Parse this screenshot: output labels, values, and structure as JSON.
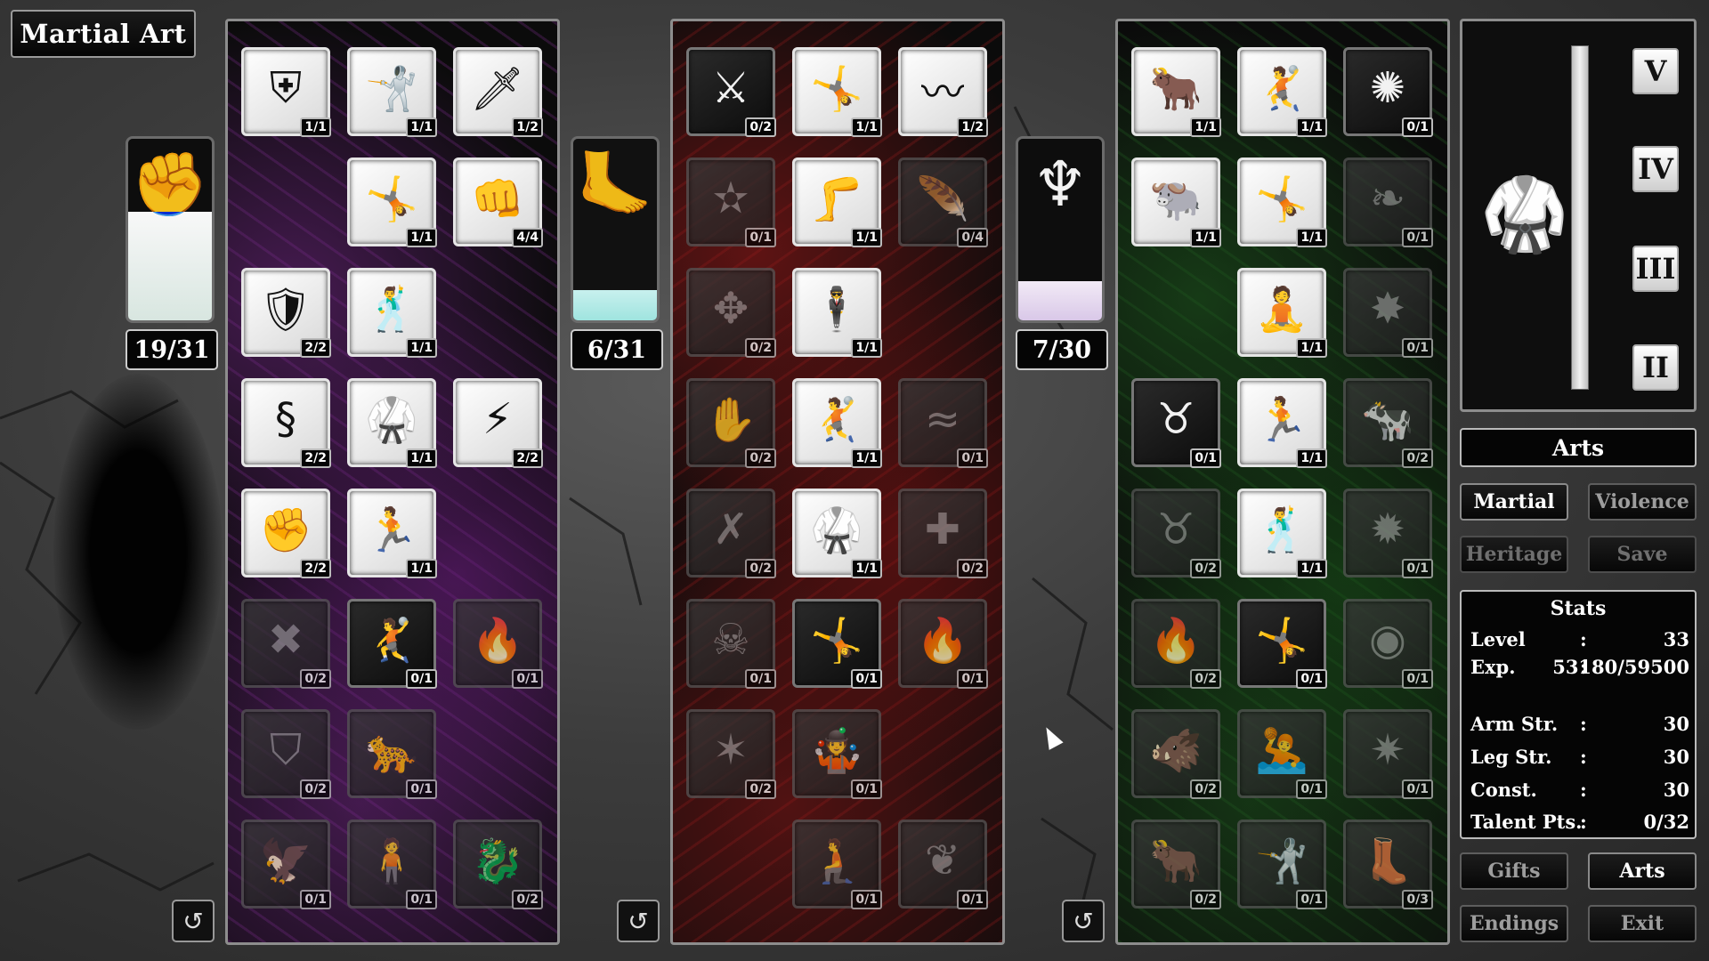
{
  "title": "Martial Art",
  "trees": [
    {
      "theme": "purple",
      "counter": "19/31",
      "category_icon": "fist-icon",
      "category_progress": 0.61,
      "skills": [
        {
          "icon": "shield-icon",
          "glyph": "⛨",
          "count": "1/1",
          "state": "unlocked"
        },
        {
          "icon": "fighter-punch-icon",
          "glyph": "🤺",
          "count": "1/1",
          "state": "unlocked"
        },
        {
          "icon": "sword-strike-icon",
          "glyph": "🗡",
          "count": "1/2",
          "state": "unlocked"
        },
        null,
        {
          "icon": "fighter-lunge-icon",
          "glyph": "🤸",
          "count": "1/1",
          "state": "unlocked"
        },
        {
          "icon": "fast-fist-icon",
          "glyph": "👊",
          "count": "4/4",
          "state": "unlocked"
        },
        {
          "icon": "black-shield-icon",
          "glyph": "🛡",
          "count": "2/2",
          "state": "unlocked"
        },
        {
          "icon": "fighter-stance-icon",
          "glyph": "🕺",
          "count": "1/1",
          "state": "unlocked"
        },
        null,
        {
          "icon": "serpent-icon",
          "glyph": "§",
          "count": "2/2",
          "state": "unlocked"
        },
        {
          "icon": "fighter-guard-icon",
          "glyph": "🥋",
          "count": "1/1",
          "state": "unlocked"
        },
        {
          "icon": "lightning-fist-icon",
          "glyph": "⚡",
          "count": "2/2",
          "state": "unlocked"
        },
        {
          "icon": "shield-fist-icon",
          "glyph": "✊",
          "count": "2/2",
          "state": "unlocked"
        },
        {
          "icon": "fighter-hook-icon",
          "glyph": "🏃",
          "count": "1/1",
          "state": "unlocked"
        },
        null,
        {
          "icon": "crossed-arms-icon",
          "glyph": "✖",
          "count": "0/2",
          "state": "locked"
        },
        {
          "icon": "fighter-kick-high-icon",
          "glyph": "🤾",
          "count": "0/1",
          "state": "dark"
        },
        {
          "icon": "flaming-fist-icon",
          "glyph": "🔥",
          "count": "0/1",
          "state": "locked"
        },
        {
          "icon": "shield-strike-icon",
          "glyph": "⛉",
          "count": "0/2",
          "state": "locked"
        },
        {
          "icon": "fighter-crouch-icon",
          "glyph": "🐆",
          "count": "0/1",
          "state": "locked"
        },
        null,
        {
          "icon": "phoenix-icon",
          "glyph": "🦅",
          "count": "0/1",
          "state": "locked"
        },
        {
          "icon": "fighter-pose-icon",
          "glyph": "🧍",
          "count": "0/1",
          "state": "locked"
        },
        {
          "icon": "dragon-flame-icon",
          "glyph": "🐉",
          "count": "0/2",
          "state": "locked"
        }
      ]
    },
    {
      "theme": "red",
      "counter": "6/31",
      "category_icon": "foot-icon",
      "category_progress": 0.19,
      "skills": [
        {
          "icon": "crossed-swords-icon",
          "glyph": "⚔",
          "count": "0/2",
          "state": "dark"
        },
        {
          "icon": "fighter-kneel-kick-icon",
          "glyph": "🤸",
          "count": "1/1",
          "state": "unlocked"
        },
        {
          "icon": "flowing-hair-icon",
          "glyph": "〰",
          "count": "1/2",
          "state": "unlocked"
        },
        {
          "icon": "star-orbit-icon",
          "glyph": "✫",
          "count": "0/1",
          "state": "locked"
        },
        {
          "icon": "fighter-side-kick-icon",
          "glyph": "🦵",
          "count": "1/1",
          "state": "unlocked"
        },
        {
          "icon": "feathered-wing-icon",
          "glyph": "🪶",
          "count": "0/4",
          "state": "locked"
        },
        {
          "icon": "sword-hands-icon",
          "glyph": "✥",
          "count": "0/2",
          "state": "locked"
        },
        {
          "icon": "fighter-knee-icon",
          "glyph": "🕴",
          "count": "1/1",
          "state": "unlocked"
        },
        null,
        {
          "icon": "grab-star-icon",
          "glyph": "✋",
          "count": "0/2",
          "state": "locked"
        },
        {
          "icon": "fighter-flying-kick-icon",
          "glyph": "🤾",
          "count": "1/1",
          "state": "unlocked"
        },
        {
          "icon": "hair-swirl-icon",
          "glyph": "≈",
          "count": "0/1",
          "state": "locked"
        },
        {
          "icon": "bound-hands-icon",
          "glyph": "✗",
          "count": "0/2",
          "state": "locked"
        },
        {
          "icon": "fighter-high-kick-icon",
          "glyph": "🥋",
          "count": "1/1",
          "state": "unlocked"
        },
        {
          "icon": "hair-heal-icon",
          "glyph": "✚",
          "count": "0/2",
          "state": "locked"
        },
        {
          "icon": "skull-orbit-icon",
          "glyph": "☠",
          "count": "0/1",
          "state": "locked"
        },
        {
          "icon": "fighter-split-icon",
          "glyph": "🤸",
          "count": "0/1",
          "state": "dark"
        },
        {
          "icon": "flames-icon",
          "glyph": "🔥",
          "count": "0/1",
          "state": "locked"
        },
        {
          "icon": "stars-hands-icon",
          "glyph": "✶",
          "count": "0/2",
          "state": "locked"
        },
        {
          "icon": "fighter-handstand-icon",
          "glyph": "🤹",
          "count": "0/1",
          "state": "locked"
        },
        null,
        null,
        {
          "icon": "fighter-dive-icon",
          "glyph": "🧎",
          "count": "0/1",
          "state": "locked"
        },
        {
          "icon": "hoof-icon",
          "glyph": "❦",
          "count": "0/1",
          "state": "locked"
        }
      ]
    },
    {
      "theme": "green",
      "counter": "7/30",
      "category_icon": "horn-icon",
      "category_progress": 0.23,
      "skills": [
        {
          "icon": "bull-icon",
          "glyph": "🐂",
          "count": "1/1",
          "state": "unlocked"
        },
        {
          "icon": "fighter-leap-icon",
          "glyph": "🤾",
          "count": "1/1",
          "state": "unlocked"
        },
        {
          "icon": "burst-icon",
          "glyph": "✺",
          "count": "0/1",
          "state": "dark"
        },
        {
          "icon": "bull-charge-icon",
          "glyph": "🐃",
          "count": "1/1",
          "state": "unlocked"
        },
        {
          "icon": "fighter-spin-icon",
          "glyph": "🤸",
          "count": "1/1",
          "state": "unlocked"
        },
        {
          "icon": "lungs-icon",
          "glyph": "❧",
          "count": "0/1",
          "state": "locked"
        },
        null,
        {
          "icon": "fighter-twist-icon",
          "glyph": "🧘",
          "count": "1/1",
          "state": "unlocked"
        },
        {
          "icon": "splat-icon",
          "glyph": "✸",
          "count": "0/1",
          "state": "locked"
        },
        {
          "icon": "bull-shield-icon",
          "glyph": "♉",
          "count": "0/1",
          "state": "dark"
        },
        {
          "icon": "fighter-dash-icon",
          "glyph": "🏃",
          "count": "1/1",
          "state": "unlocked"
        },
        {
          "icon": "bull-standing-icon",
          "glyph": "🐄",
          "count": "0/2",
          "state": "locked"
        },
        {
          "icon": "bull-head-icon",
          "glyph": "♉",
          "count": "0/2",
          "state": "locked"
        },
        {
          "icon": "fighter-ready-icon",
          "glyph": "🕺",
          "count": "1/1",
          "state": "unlocked"
        },
        {
          "icon": "big-splat-icon",
          "glyph": "✹",
          "count": "0/1",
          "state": "locked"
        },
        {
          "icon": "bull-flame-icon",
          "glyph": "🔥",
          "count": "0/2",
          "state": "locked"
        },
        {
          "icon": "fighter-bent-icon",
          "glyph": "🤸",
          "count": "0/1",
          "state": "dark"
        },
        {
          "icon": "rear-icon",
          "glyph": "◉",
          "count": "0/1",
          "state": "locked"
        },
        {
          "icon": "beast-roar-icon",
          "glyph": "🐗",
          "count": "0/2",
          "state": "locked"
        },
        {
          "icon": "fighter-slide-icon",
          "glyph": "🤽",
          "count": "0/1",
          "state": "locked"
        },
        {
          "icon": "spiky-blob-icon",
          "glyph": "✷",
          "count": "0/1",
          "state": "locked"
        },
        {
          "icon": "bull-rage-icon",
          "glyph": "🐂",
          "count": "0/2",
          "state": "locked"
        },
        {
          "icon": "fighter-fall-icon",
          "glyph": "🤺",
          "count": "0/1",
          "state": "locked"
        },
        {
          "icon": "boots-icon",
          "glyph": "👢",
          "count": "0/3",
          "state": "locked"
        }
      ]
    }
  ],
  "tiers": {
    "labels": [
      "V",
      "IV",
      "III",
      "II"
    ],
    "emblem_icon": "fighter-emblem-icon"
  },
  "arts_header": "Arts",
  "tabs": {
    "martial": "Martial",
    "violence": "Violence",
    "heritage": "Heritage",
    "save": "Save"
  },
  "stats": {
    "title": "Stats",
    "rows": [
      {
        "key": "Level",
        "value": "33"
      },
      {
        "key": "Exp.",
        "value": "53180/59500"
      },
      {
        "key": "Arm Str.",
        "value": "30"
      },
      {
        "key": "Leg Str.",
        "value": "30"
      },
      {
        "key": "Const.",
        "value": "30"
      },
      {
        "key": "Talent Pts.",
        "value": "0/32"
      }
    ],
    "separator": ":"
  },
  "menu": {
    "gifts": "Gifts",
    "arts": "Arts",
    "endings": "Endings",
    "exit": "Exit"
  },
  "reset_icon": "reset-icon"
}
